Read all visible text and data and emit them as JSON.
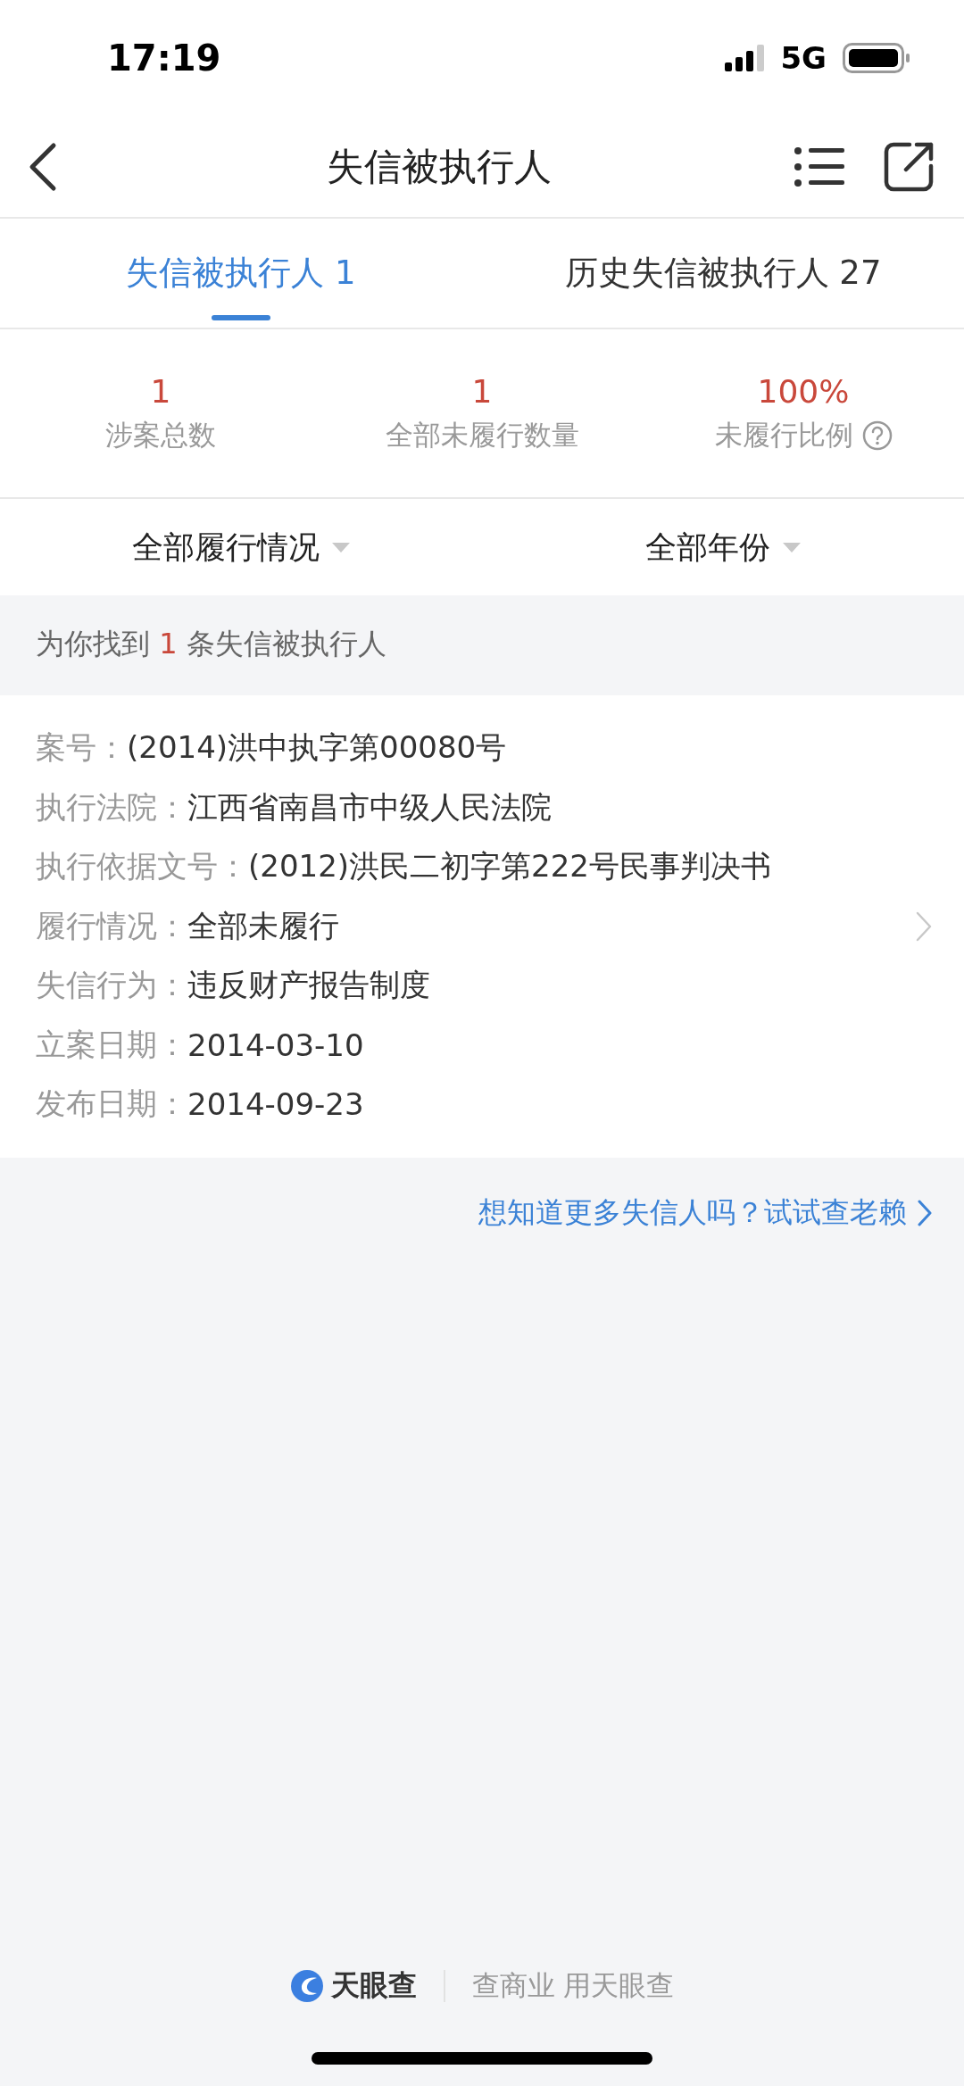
{
  "status_bar": {
    "time": "17:19",
    "network": "5G"
  },
  "nav": {
    "title": "失信被执行人"
  },
  "tabs": [
    {
      "label": "失信被执行人 1",
      "selected": true
    },
    {
      "label": "历史失信被执行人 27",
      "selected": false
    }
  ],
  "stats": [
    {
      "value": "1",
      "label": "涉案总数",
      "help": false
    },
    {
      "value": "1",
      "label": "全部未履行数量",
      "help": false
    },
    {
      "value": "100%",
      "label": "未履行比例",
      "help": true
    }
  ],
  "filters": [
    {
      "label": "全部履行情况"
    },
    {
      "label": "全部年份"
    }
  ],
  "summary": {
    "prefix": "为你找到",
    "count": "1",
    "suffix": "条失信被执行人"
  },
  "case": {
    "fields": [
      {
        "label": "案号：",
        "value": "(2014)洪中执字第00080号"
      },
      {
        "label": "执行法院：",
        "value": "江西省南昌市中级人民法院"
      },
      {
        "label": "执行依据文号：",
        "value": "(2012)洪民二初字第222号民事判决书"
      },
      {
        "label": "履行情况：",
        "value": "全部未履行"
      },
      {
        "label": "失信行为：",
        "value": "违反财产报告制度"
      },
      {
        "label": "立案日期：",
        "value": "2014-03-10"
      },
      {
        "label": "发布日期：",
        "value": "2014-09-23"
      }
    ]
  },
  "more_link": "想知道更多失信人吗？试试查老赖",
  "footer": {
    "brand": "天眼查",
    "slogan": "查商业 用天眼查"
  }
}
